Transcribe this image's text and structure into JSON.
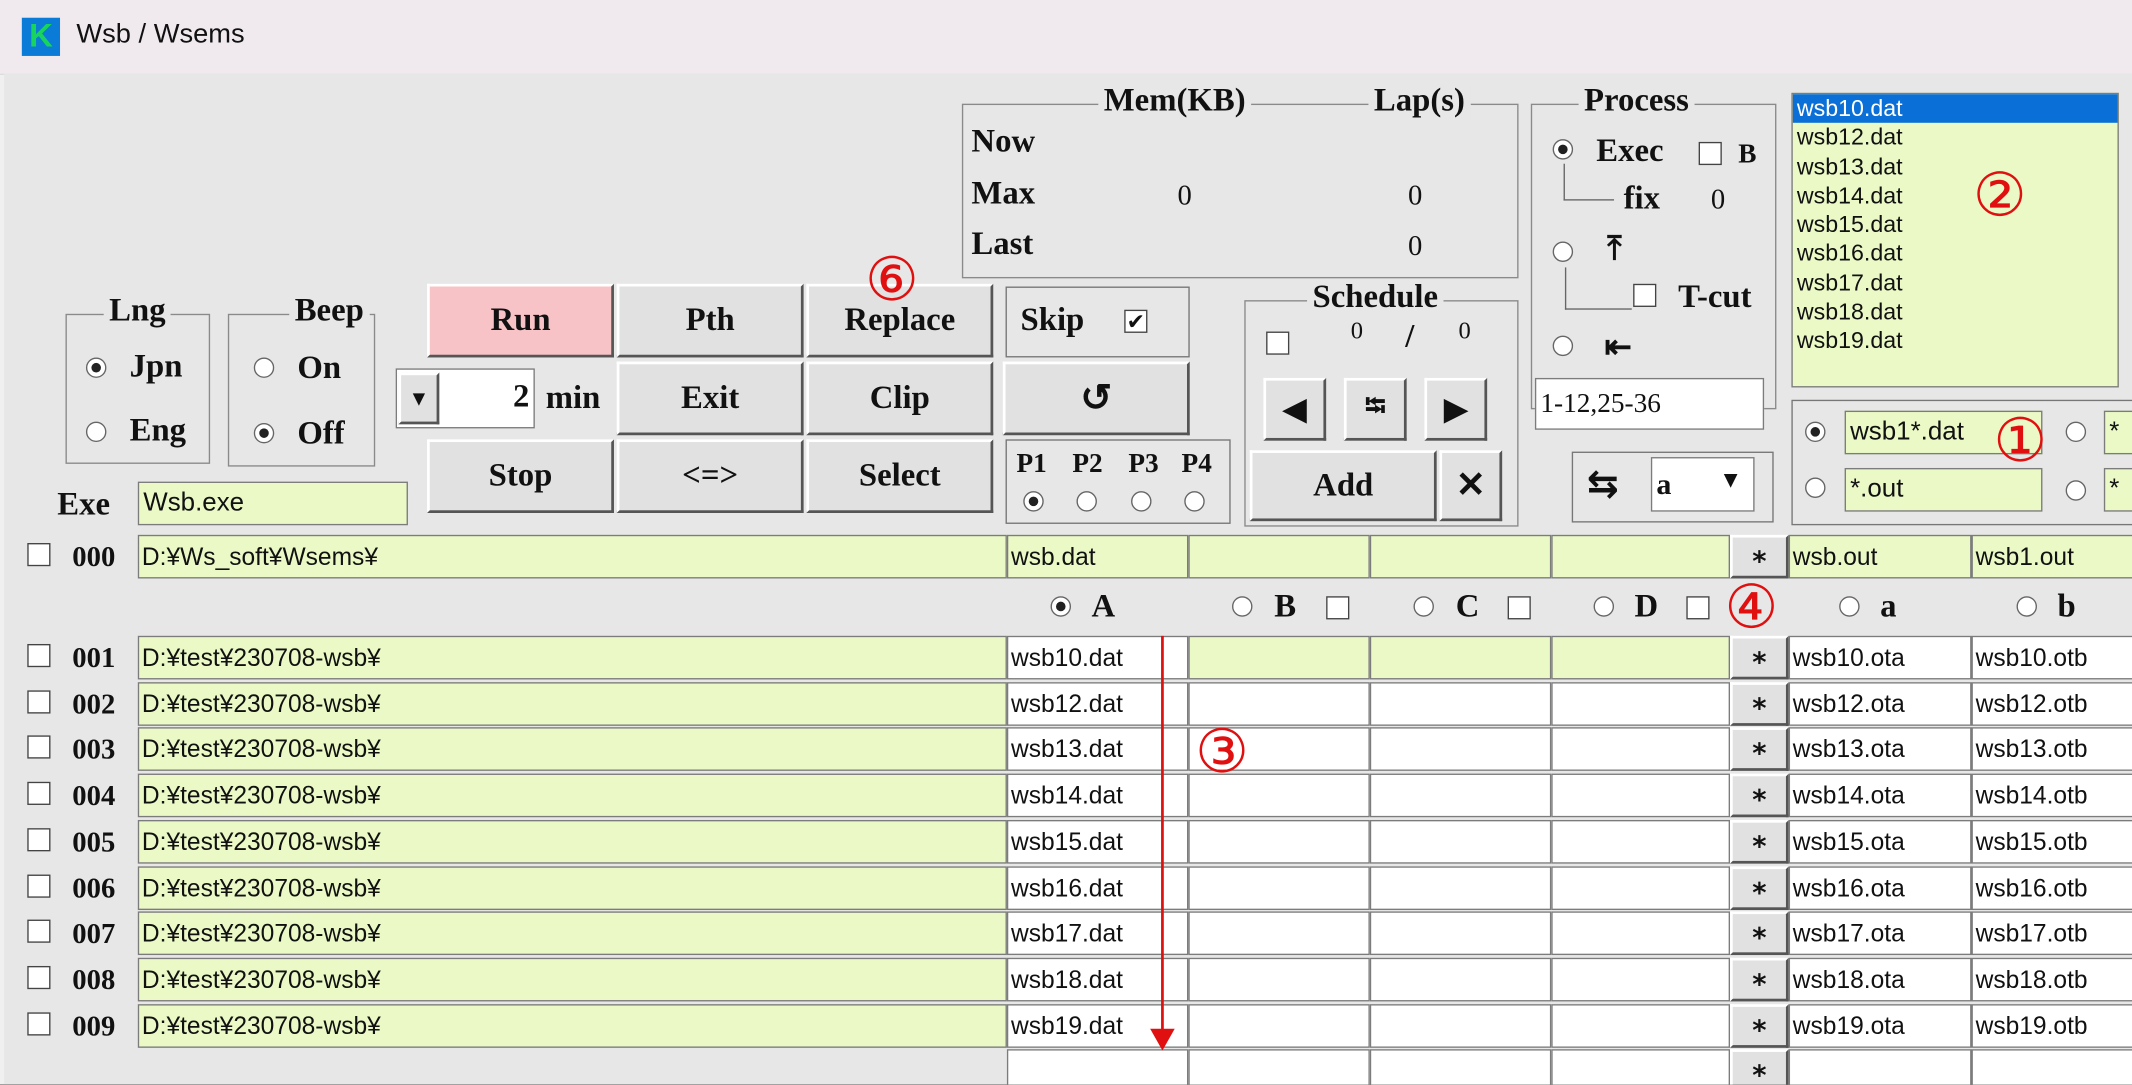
{
  "window": {
    "title": "Wsb / Wsems",
    "logo": "K"
  },
  "mem_group": {
    "mem_label": "Mem(KB)",
    "lap_label": "Lap(s)",
    "rows": [
      {
        "label": "Now",
        "mem": "",
        "lap": ""
      },
      {
        "label": "Max",
        "mem": "0",
        "lap": "0"
      },
      {
        "label": "Last",
        "mem": "",
        "lap": "0"
      }
    ]
  },
  "process": {
    "title": "Process",
    "exec_label": "Exec",
    "b_label": "B",
    "fix_label": "fix",
    "fix_value": "0",
    "tcut_label": "T-cut",
    "up_arrow": "⤒",
    "left_arrow": "⇤",
    "range_value": "1-12,25-36"
  },
  "file_list": {
    "items": [
      "wsb10.dat",
      "wsb12.dat",
      "wsb13.dat",
      "wsb14.dat",
      "wsb15.dat",
      "wsb16.dat",
      "wsb17.dat",
      "wsb18.dat",
      "wsb19.dat"
    ],
    "selected_index": 0
  },
  "lng": {
    "title": "Lng",
    "options": [
      "Jpn",
      "Eng"
    ],
    "selected": "Jpn"
  },
  "beep": {
    "title": "Beep",
    "options": [
      "On",
      "Off"
    ],
    "selected": "Off"
  },
  "buttons": {
    "run": "Run",
    "pth": "Pth",
    "replace": "Replace",
    "exit": "Exit",
    "clip": "Clip",
    "stop": "Stop",
    "swap": "<=>",
    "select": "Select",
    "refresh": "↺",
    "add": "Add",
    "delete": "✕"
  },
  "skip": {
    "label": "Skip",
    "checked": true
  },
  "minutes": {
    "value": "2",
    "unit": "min",
    "dropdown": "▾"
  },
  "pattern": {
    "labels": [
      "P1",
      "P2",
      "P3",
      "P4"
    ],
    "selected": "P1"
  },
  "schedule": {
    "title": "Schedule",
    "done": "0",
    "sep": "/",
    "total": "0",
    "prev": "◀",
    "next": "▶",
    "center_icon": "⭾"
  },
  "mode_select": {
    "value": "a",
    "swap_icon": "⇆",
    "arrow": "▾"
  },
  "filters": {
    "pattern1": "wsb1*.dat",
    "pattern2": "*.out",
    "clipped1": "*",
    "clipped2": "*"
  },
  "exe": {
    "label": "Exe",
    "value": "Wsb.exe"
  },
  "row0": {
    "num": "000",
    "path": "D:¥Ws_soft¥Wsems¥",
    "dat": "wsb.dat",
    "out_a": "wsb.out",
    "out_b": "wsb1.out"
  },
  "columns": {
    "A": "A",
    "B": "B",
    "C": "C",
    "D": "D",
    "a": "a",
    "b": "b"
  },
  "rows": [
    {
      "num": "001",
      "path": "D:¥test¥230708-wsb¥",
      "dat": "wsb10.dat",
      "ota": "wsb10.ota",
      "otb": "wsb10.otb"
    },
    {
      "num": "002",
      "path": "D:¥test¥230708-wsb¥",
      "dat": "wsb12.dat",
      "ota": "wsb12.ota",
      "otb": "wsb12.otb"
    },
    {
      "num": "003",
      "path": "D:¥test¥230708-wsb¥",
      "dat": "wsb13.dat",
      "ota": "wsb13.ota",
      "otb": "wsb13.otb"
    },
    {
      "num": "004",
      "path": "D:¥test¥230708-wsb¥",
      "dat": "wsb14.dat",
      "ota": "wsb14.ota",
      "otb": "wsb14.otb"
    },
    {
      "num": "005",
      "path": "D:¥test¥230708-wsb¥",
      "dat": "wsb15.dat",
      "ota": "wsb15.ota",
      "otb": "wsb15.otb"
    },
    {
      "num": "006",
      "path": "D:¥test¥230708-wsb¥",
      "dat": "wsb16.dat",
      "ota": "wsb16.ota",
      "otb": "wsb16.otb"
    },
    {
      "num": "007",
      "path": "D:¥test¥230708-wsb¥",
      "dat": "wsb17.dat",
      "ota": "wsb17.ota",
      "otb": "wsb17.otb"
    },
    {
      "num": "008",
      "path": "D:¥test¥230708-wsb¥",
      "dat": "wsb18.dat",
      "ota": "wsb18.ota",
      "otb": "wsb18.otb"
    },
    {
      "num": "009",
      "path": "D:¥test¥230708-wsb¥",
      "dat": "wsb19.dat",
      "ota": "wsb19.ota",
      "otb": "wsb19.otb"
    }
  ],
  "star": "*",
  "annotations": {
    "c1": "①",
    "c2": "②",
    "c3": "③",
    "c4": "④",
    "c6": "⑥",
    "color": "#e01010"
  }
}
